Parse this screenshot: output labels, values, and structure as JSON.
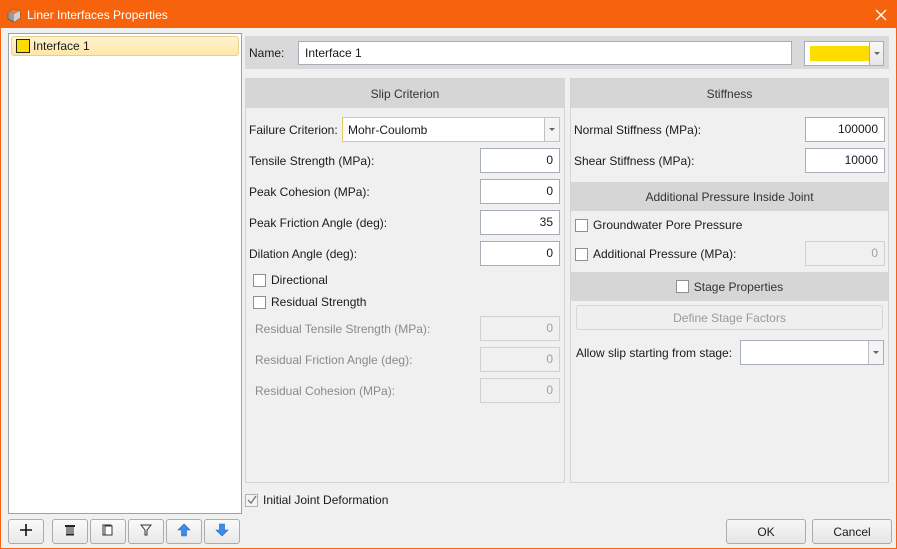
{
  "window": {
    "title": "Liner Interfaces Properties",
    "app_icon": "liner-icon",
    "close_icon": "close-icon"
  },
  "list": {
    "items": [
      {
        "label": "Interface 1",
        "color": "#ffdc00",
        "selected": true
      }
    ]
  },
  "toolbar": {
    "buttons": [
      {
        "name": "add",
        "icon": "plus-icon"
      },
      {
        "name": "delete",
        "icon": "trash-icon"
      },
      {
        "name": "copy",
        "icon": "copy-icon"
      },
      {
        "name": "filter",
        "icon": "filter-icon"
      },
      {
        "name": "move-up",
        "icon": "arrow-up-icon"
      },
      {
        "name": "move-down",
        "icon": "arrow-down-icon"
      }
    ]
  },
  "name_row": {
    "label": "Name:",
    "value": "Interface 1",
    "color": "#ffdc00"
  },
  "slip_criterion": {
    "header": "Slip Criterion",
    "failure_criterion_label": "Failure Criterion:",
    "failure_criterion_value": "Mohr-Coulomb",
    "fields": [
      {
        "label": "Tensile Strength (MPa):",
        "value": "0"
      },
      {
        "label": "Peak Cohesion (MPa):",
        "value": "0"
      },
      {
        "label": "Peak Friction Angle (deg):",
        "value": "35"
      },
      {
        "label": "Dilation Angle (deg):",
        "value": "0"
      }
    ],
    "directional_label": "Directional",
    "directional_checked": false,
    "residual_label": "Residual Strength",
    "residual_checked": false,
    "residual_fields": [
      {
        "label": "Residual Tensile Strength (MPa):",
        "value": "0"
      },
      {
        "label": "Residual Friction Angle (deg):",
        "value": "0"
      },
      {
        "label": "Residual Cohesion (MPa):",
        "value": "0"
      }
    ]
  },
  "stiffness": {
    "header": "Stiffness",
    "fields": [
      {
        "label": "Normal Stiffness (MPa):",
        "value": "100000"
      },
      {
        "label": "Shear Stiffness (MPa):",
        "value": "10000"
      }
    ]
  },
  "pressure": {
    "header": "Additional Pressure Inside Joint",
    "groundwater_label": "Groundwater Pore Pressure",
    "groundwater_checked": false,
    "additional_label": "Additional Pressure (MPa):",
    "additional_checked": false,
    "additional_value": "0"
  },
  "stage": {
    "header_label": "Stage Properties",
    "checked": false,
    "define_button": "Define Stage Factors",
    "slip_stage_label": "Allow slip starting from stage:",
    "slip_stage_value": ""
  },
  "initial_joint": {
    "label": "Initial Joint Deformation",
    "checked": true
  },
  "footer": {
    "ok": "OK",
    "cancel": "Cancel"
  }
}
